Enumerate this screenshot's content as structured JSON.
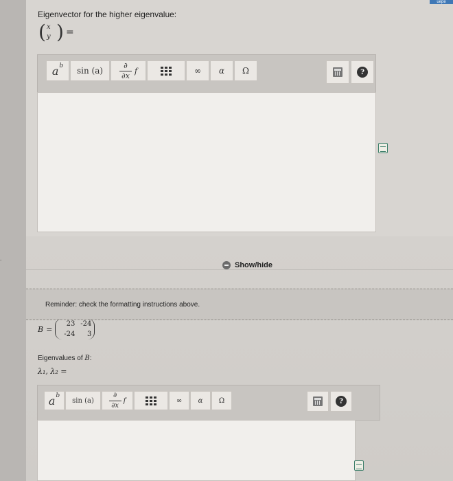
{
  "header_tab": "uepe",
  "question1": {
    "prompt": "Eigenvector for the higher eigenvalue:",
    "vector_x": "x",
    "vector_y": "y",
    "equals": "=",
    "toolbar": [
      "a^b",
      "sin(a)",
      "∂/∂x f",
      "matrix",
      "∞",
      "α",
      "Ω"
    ],
    "labels": {
      "power": "a",
      "power_sup": "b",
      "sin": "sin (a)",
      "deriv_top": "∂",
      "deriv_bottom": "∂x",
      "deriv_f": "f",
      "infinity": "∞",
      "alpha": "α",
      "omega": "Ω",
      "help": "?"
    }
  },
  "section_mark": ".",
  "show_hide": "Show/hide",
  "reminder": "Reminder: check the formatting instructions above.",
  "matrix": {
    "name": "B",
    "equals": "=",
    "values": [
      "23",
      "-24",
      "-24",
      "3"
    ]
  },
  "question2": {
    "eigen_label": "Eigenvalues of",
    "eigen_var": "B",
    "eigen_colon": ":",
    "lambda_line": "λ₁, λ₂ =",
    "labels": {
      "power": "a",
      "power_sup": "b",
      "sin": "sin (a)",
      "deriv_top": "∂",
      "deriv_bottom": "∂x",
      "deriv_f": "f",
      "infinity": "∞",
      "alpha": "α",
      "omega": "Ω",
      "help": "?"
    }
  },
  "colors": {
    "toolbar": "#c8c5c1",
    "editor": "#f1efec",
    "page": "#d8d5d1"
  }
}
